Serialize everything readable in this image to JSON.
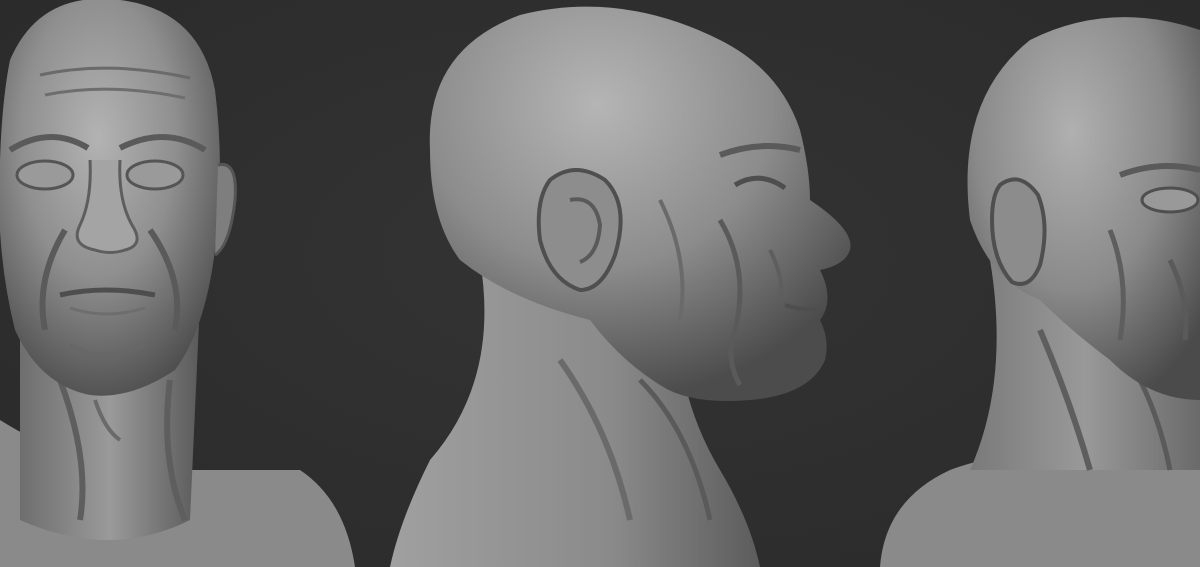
{
  "scene": {
    "background_color": "#2f2f2f",
    "material_color": "#8c8c8c",
    "views": [
      {
        "name": "front-view"
      },
      {
        "name": "side-view"
      },
      {
        "name": "three-quarter-view"
      }
    ]
  }
}
